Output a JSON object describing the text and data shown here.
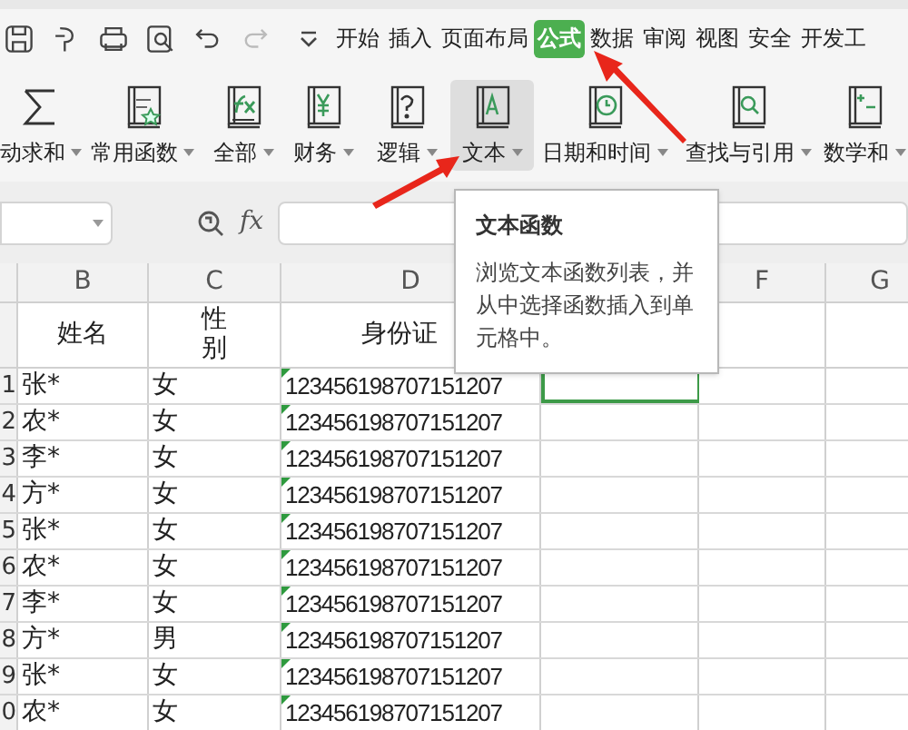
{
  "tabs": [
    {
      "label": "开始",
      "selected": false
    },
    {
      "label": "插入",
      "selected": false
    },
    {
      "label": "页面布局",
      "selected": false
    },
    {
      "label": "公式",
      "selected": true
    },
    {
      "label": "数据",
      "selected": false
    },
    {
      "label": "审阅",
      "selected": false
    },
    {
      "label": "视图",
      "selected": false
    },
    {
      "label": "安全",
      "selected": false
    },
    {
      "label": "开发工",
      "selected": false
    }
  ],
  "ribbon": [
    {
      "label": "动求和",
      "kind": "sum",
      "selected": false
    },
    {
      "label": "常用函数",
      "kind": "favorite",
      "selected": false
    },
    {
      "label": "全部",
      "kind": "fx",
      "selected": false
    },
    {
      "label": "财务",
      "kind": "yen",
      "selected": false
    },
    {
      "label": "逻辑",
      "kind": "question",
      "selected": false
    },
    {
      "label": "文本",
      "kind": "text",
      "selected": true
    },
    {
      "label": "日期和时间",
      "kind": "clock",
      "selected": false
    },
    {
      "label": "查找与引用",
      "kind": "search",
      "selected": false
    },
    {
      "label": "数学和",
      "kind": "math",
      "selected": false
    }
  ],
  "formula_bar": {
    "fx_label": "fx"
  },
  "columns": [
    {
      "letter": "B"
    },
    {
      "letter": "C"
    },
    {
      "letter": "D"
    },
    {},
    {
      "letter": "F"
    },
    {
      "letter": "G"
    }
  ],
  "header_row": {
    "name": "姓名",
    "gender": "性别",
    "id": "身份证"
  },
  "rows": [
    {
      "number": "1",
      "name": "张*",
      "gender": "女",
      "id": "123456198707151207",
      "flagged": true,
      "e_cell_selected": true
    },
    {
      "number": "2",
      "name": "农*",
      "gender": "女",
      "id": "123456198707151207",
      "flagged": true,
      "e_cell_selected": false
    },
    {
      "number": "3",
      "name": "李*",
      "gender": "女",
      "id": "123456198707151207",
      "flagged": true,
      "e_cell_selected": false
    },
    {
      "number": "4",
      "name": "方*",
      "gender": "女",
      "id": "123456198707151207",
      "flagged": true,
      "e_cell_selected": false
    },
    {
      "number": "5",
      "name": "张*",
      "gender": "女",
      "id": "123456198707151207",
      "flagged": true,
      "e_cell_selected": false
    },
    {
      "number": "6",
      "name": "农*",
      "gender": "女",
      "id": "123456198707151207",
      "flagged": true,
      "e_cell_selected": false
    },
    {
      "number": "7",
      "name": "李*",
      "gender": "女",
      "id": "123456198707151207",
      "flagged": true,
      "e_cell_selected": false
    },
    {
      "number": "8",
      "name": "方*",
      "gender": "男",
      "id": "123456198707151207",
      "flagged": true,
      "e_cell_selected": false
    },
    {
      "number": "9",
      "name": "张*",
      "gender": "女",
      "id": "123456198707151207",
      "flagged": true,
      "e_cell_selected": false
    },
    {
      "number": "0",
      "name": "农*",
      "gender": "女",
      "id": "123456198707151207",
      "flagged": true,
      "e_cell_selected": false
    }
  ],
  "tooltip": {
    "title": "文本函数",
    "body": "浏览文本函数列表，并从中选择函数插入到单元格中。"
  }
}
